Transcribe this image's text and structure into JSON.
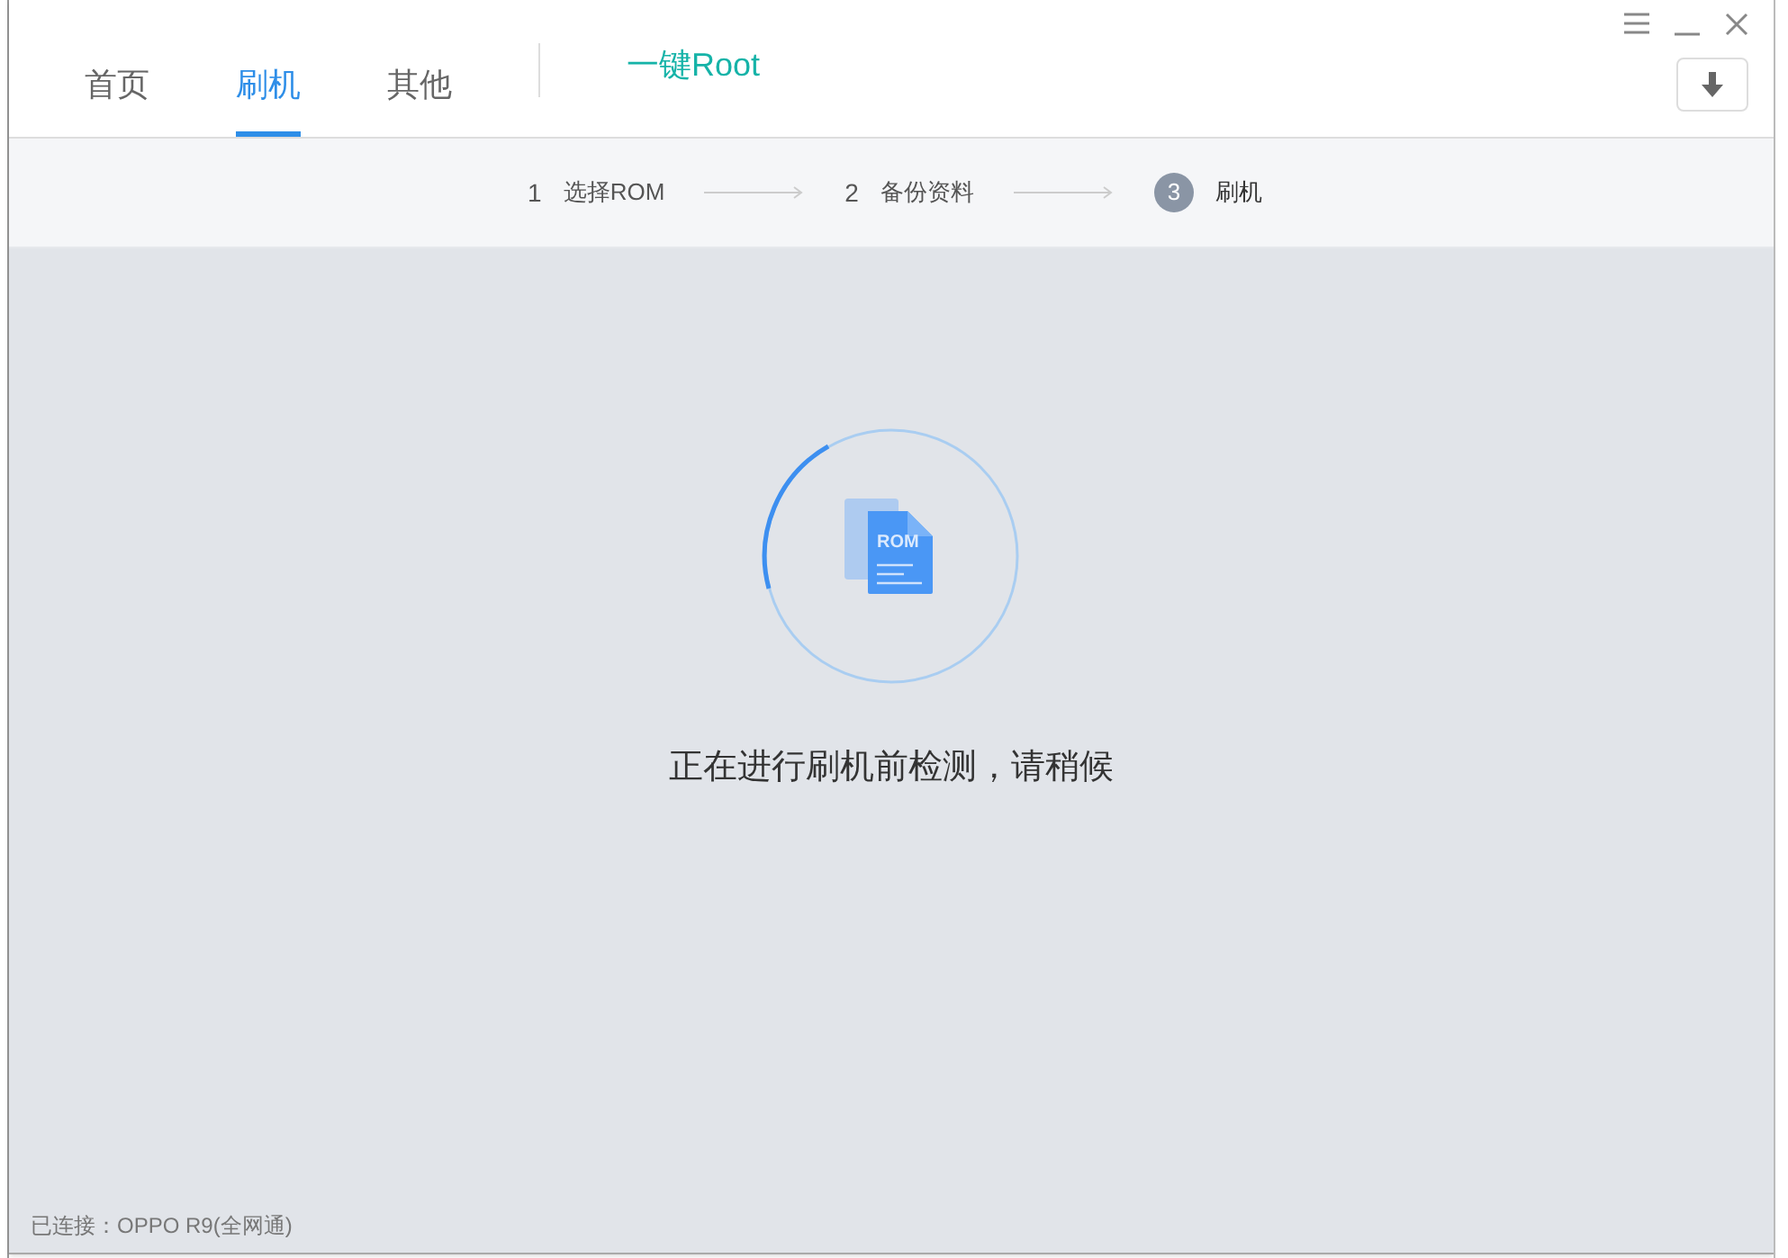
{
  "tabs": [
    {
      "label": "首页",
      "selected": false
    },
    {
      "label": "刷机",
      "selected": true
    },
    {
      "label": "其他",
      "selected": false
    }
  ],
  "root_link": "一键Root",
  "steps": [
    {
      "number": "1",
      "label": "选择ROM",
      "selected": false
    },
    {
      "number": "2",
      "label": "备份资料",
      "selected": false
    },
    {
      "number": "3",
      "label": "刷机",
      "selected": true
    }
  ],
  "progress": {
    "icon_label": "ROM",
    "message": "正在进行刷机前检测，请稍候"
  },
  "status_bar": "已连接：OPPO R9(全网通)"
}
